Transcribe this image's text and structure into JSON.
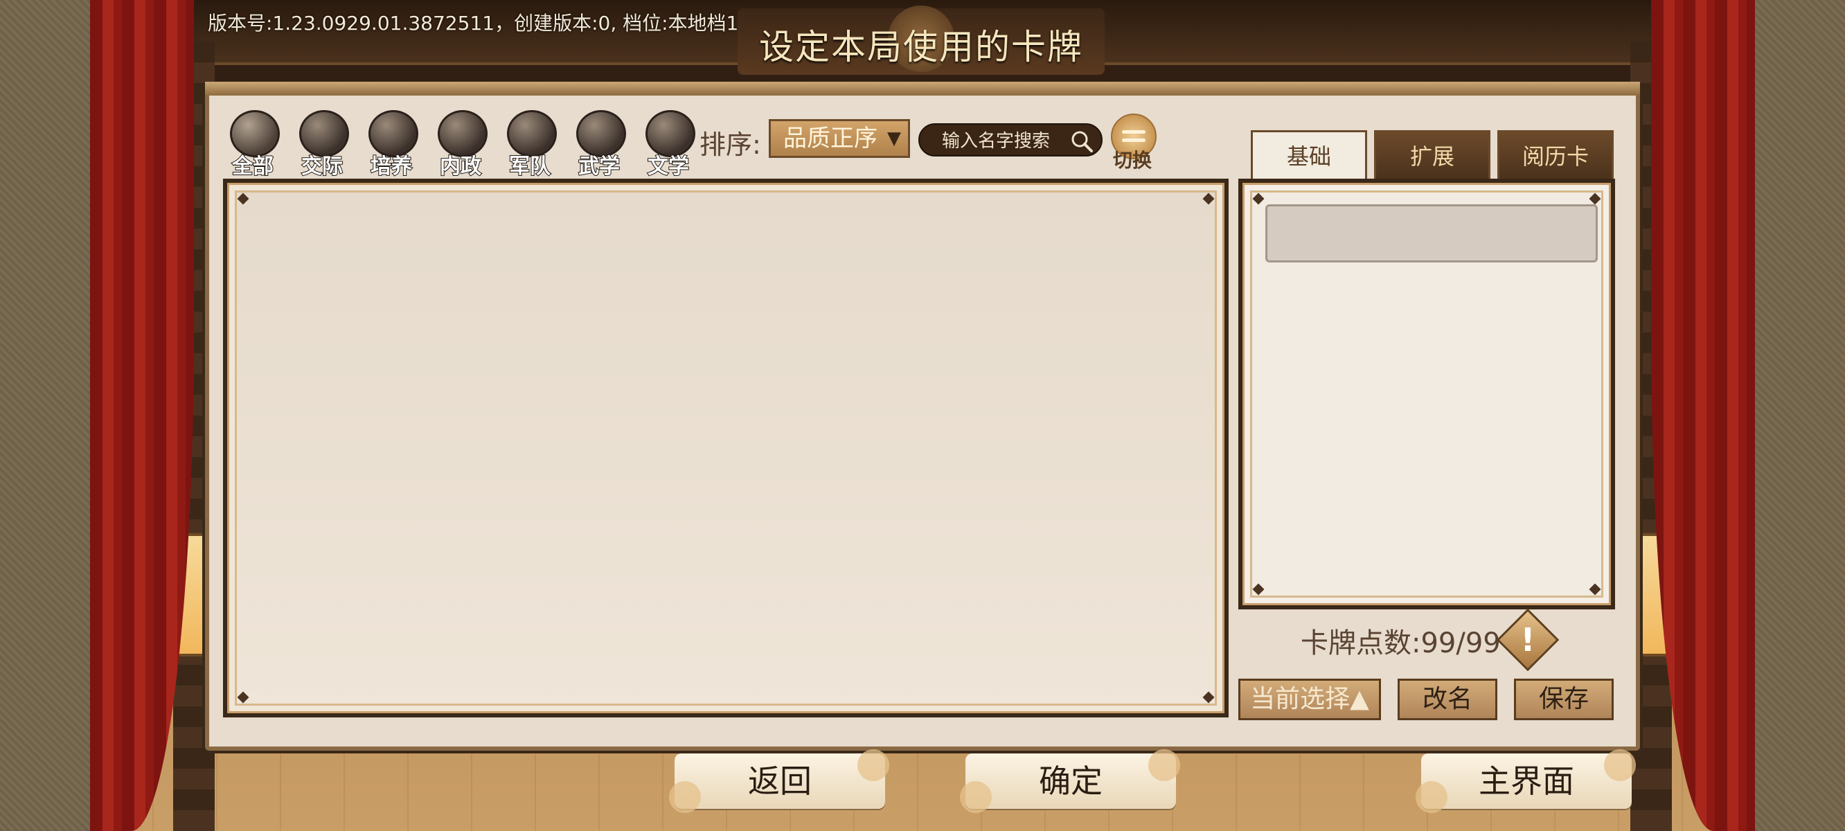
{
  "header": {
    "version_text": "版本号:1.23.0929.01.3872511，创建版本:0, 档位:本地档1",
    "title": "设定本局使用的卡牌"
  },
  "categories": [
    {
      "label": "全部",
      "icon": "all-icon"
    },
    {
      "label": "交际",
      "icon": "social-icon"
    },
    {
      "label": "培养",
      "icon": "cultivate-icon"
    },
    {
      "label": "内政",
      "icon": "domestic-icon"
    },
    {
      "label": "军队",
      "icon": "army-icon"
    },
    {
      "label": "武学",
      "icon": "martial-icon"
    },
    {
      "label": "文学",
      "icon": "literature-icon"
    }
  ],
  "sort": {
    "label": "排序:",
    "value": "品质正序",
    "arrow": "▼"
  },
  "search": {
    "placeholder": "输入名字搜索"
  },
  "toggle": {
    "label": "切换"
  },
  "tabs": [
    {
      "label": "基础",
      "active": true
    },
    {
      "label": "扩展",
      "active": false
    },
    {
      "label": "阅历卡",
      "active": false
    }
  ],
  "deck": {
    "points_text": "卡牌点数:99/99",
    "warn_symbol": "!",
    "current_select": "当前选择▲",
    "rename": "改名",
    "save": "保存"
  },
  "bottom": {
    "back": "返回",
    "confirm": "确定",
    "home": "主界面"
  },
  "colors": {
    "accent_dark": "#3a2818",
    "parchment": "#e7dccd",
    "button_gold": "#d2ab78"
  }
}
